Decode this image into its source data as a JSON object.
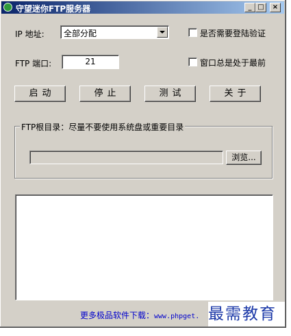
{
  "window": {
    "title": "守望迷你FTP服务器",
    "controls": {
      "minimize": "_",
      "maximize": "□",
      "close": "×"
    }
  },
  "server": {
    "ip_label": "IP 地址:",
    "ip_selected": "全部分配",
    "port_label": "FTP 端口:",
    "port_value": "21"
  },
  "options": {
    "login_check_label": "是否需要登陆验证",
    "always_on_top_label": "窗口总是处于最前"
  },
  "buttons": {
    "start": "启动",
    "stop": "停止",
    "test": "测试",
    "about": "关于"
  },
  "root_dir": {
    "group_title": "FTP根目录：尽量不要使用系统盘或重要目录",
    "path_value": "",
    "browse_label": "浏览..."
  },
  "log": {
    "content": ""
  },
  "footer": {
    "link_text": "更多极品软件下载：",
    "link_url": "www.phpget.",
    "watermark": "最需教育"
  },
  "colors": {
    "face": "#d4d0c8",
    "title_start": "#0a246a",
    "title_end": "#a6caf0",
    "link": "#0000cc",
    "watermark": "#1c39a8"
  }
}
